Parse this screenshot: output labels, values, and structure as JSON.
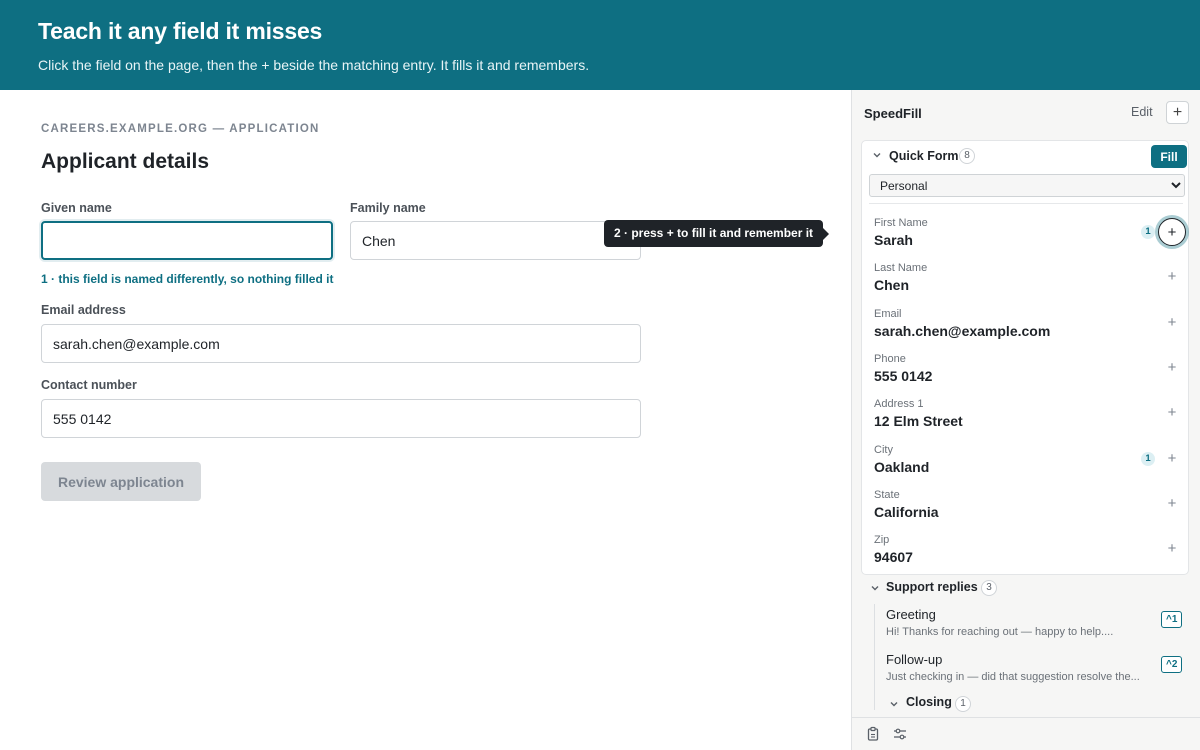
{
  "banner": {
    "title": "Teach it any field it misses",
    "subtitle": "Click the field on the page, then the + beside the matching entry. It fills it and remembers."
  },
  "form": {
    "site_label": "CAREERS.EXAMPLE.ORG — APPLICATION",
    "title": "Applicant details",
    "given_name_label": "Given name",
    "given_name_value": "",
    "family_name_label": "Family name",
    "family_name_value": "Chen",
    "hint": "1 · this field is named differently, so nothing filled it",
    "email_label": "Email address",
    "email_value": "sarah.chen@example.com",
    "contact_label": "Contact number",
    "contact_value": "555 0142",
    "review_label": "Review application"
  },
  "tooltip": "2 · press + to fill it and remember it",
  "sidebar": {
    "title": "SpeedFill",
    "edit_label": "Edit",
    "add_label": "+",
    "quick_form": {
      "name": "Quick Form",
      "count": "8",
      "fill_label": "Fill",
      "profile_options": [
        "Personal"
      ],
      "selected_profile": "Personal",
      "entries": [
        {
          "label": "First Name",
          "value": "Sarah",
          "badge": "1",
          "active": true
        },
        {
          "label": "Last Name",
          "value": "Chen"
        },
        {
          "label": "Email",
          "value": "sarah.chen@example.com"
        },
        {
          "label": "Phone",
          "value": "555 0142"
        },
        {
          "label": "Address 1",
          "value": "12 Elm Street"
        },
        {
          "label": "City",
          "value": "Oakland",
          "badge": "1"
        },
        {
          "label": "State",
          "value": "California"
        },
        {
          "label": "Zip",
          "value": "94607"
        }
      ]
    },
    "support": {
      "name": "Support replies",
      "count": "3",
      "replies": [
        {
          "title": "Greeting",
          "text": "Hi! Thanks for reaching out — happy to help....",
          "shortcut": "^1"
        },
        {
          "title": "Follow-up",
          "text": "Just checking in — did that suggestion resolve the...",
          "shortcut": "^2"
        }
      ],
      "closing": {
        "name": "Closing",
        "count": "1"
      }
    }
  },
  "colors": {
    "accent": "#0e6f82",
    "banner_bg": "#0e6f82",
    "tooltip_bg": "#1f2328",
    "sidebar_bg": "#f6f6f5"
  }
}
